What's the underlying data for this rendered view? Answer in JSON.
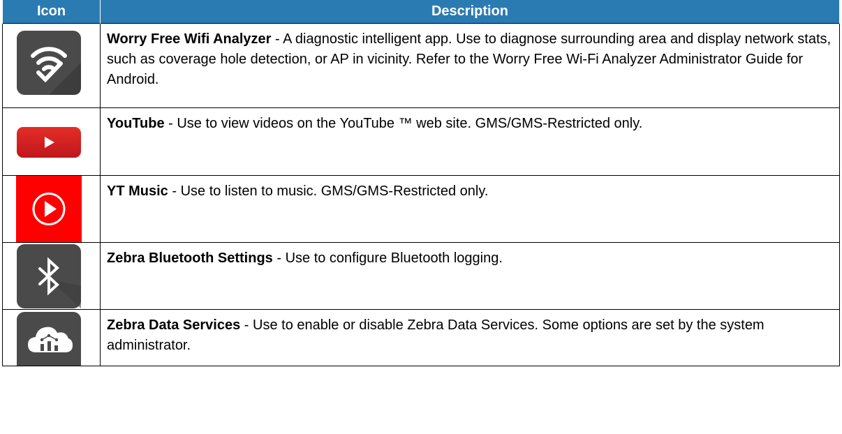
{
  "table": {
    "headers": {
      "icon": "Icon",
      "description": "Description"
    },
    "rows": [
      {
        "name": "Worry Free Wifi Analyzer",
        "text": " - A diagnostic intelligent app. Use to diagnose surrounding area and display network stats, such as coverage hole detection, or AP in vicinity. Refer to the Worry Free Wi-Fi Analyzer Administrator Guide for Android.",
        "icon": "wifi-analyzer-icon"
      },
      {
        "name": "YouTube",
        "text": " - Use to view videos on the YouTube ™ web site. GMS/GMS-Restricted only.",
        "icon": "youtube-icon"
      },
      {
        "name": "YT Music",
        "text": " - Use to listen to music. GMS/GMS-Restricted only.",
        "icon": "yt-music-icon"
      },
      {
        "name": "Zebra Bluetooth Settings",
        "text": " - Use to configure Bluetooth logging.",
        "icon": "bluetooth-icon"
      },
      {
        "name": "Zebra Data Services",
        "text": " - Use to enable or disable Zebra Data Services. Some options are set by the system administrator.",
        "icon": "cloud-data-icon"
      }
    ]
  },
  "colors": {
    "header_bg": "#2a7bb2",
    "header_text": "#ffffff",
    "youtube_red": "#e62117",
    "ytmusic_red": "#ff0000",
    "icon_dark": "#4a4a4a"
  }
}
